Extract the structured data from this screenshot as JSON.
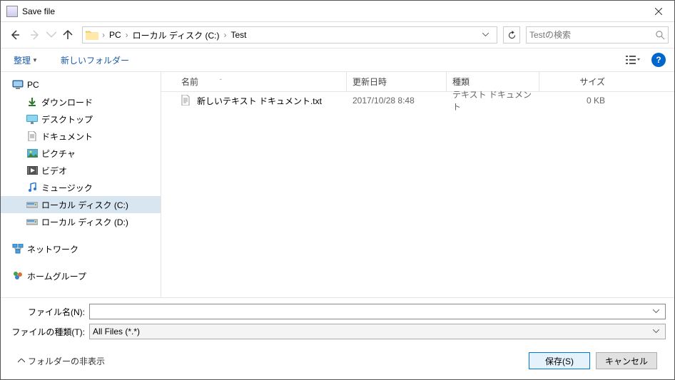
{
  "title": "Save file",
  "breadcrumbs": [
    "PC",
    "ローカル ディスク (C:)",
    "Test"
  ],
  "search_placeholder": "Testの検索",
  "toolbar": {
    "organize": "整理",
    "new_folder": "新しいフォルダー"
  },
  "sidebar": {
    "pc": "PC",
    "downloads": "ダウンロード",
    "desktop": "デスクトップ",
    "documents": "ドキュメント",
    "pictures": "ピクチャ",
    "videos": "ビデオ",
    "music": "ミュージック",
    "drive_c": "ローカル ディスク (C:)",
    "drive_d": "ローカル ディスク (D:)",
    "network": "ネットワーク",
    "homegroup": "ホームグループ"
  },
  "columns": {
    "name": "名前",
    "date": "更新日時",
    "type": "種類",
    "size": "サイズ"
  },
  "files": [
    {
      "name": "新しいテキスト ドキュメント.txt",
      "date": "2017/10/28 8:48",
      "type": "テキスト ドキュメント",
      "size": "0 KB"
    }
  ],
  "form": {
    "filename_label": "ファイル名(N):",
    "filetype_label": "ファイルの種類(T):",
    "filetype_value": "All Files (*.*)"
  },
  "footer": {
    "hide_folders": "フォルダーの非表示",
    "save": "保存(S)",
    "cancel": "キャンセル"
  }
}
